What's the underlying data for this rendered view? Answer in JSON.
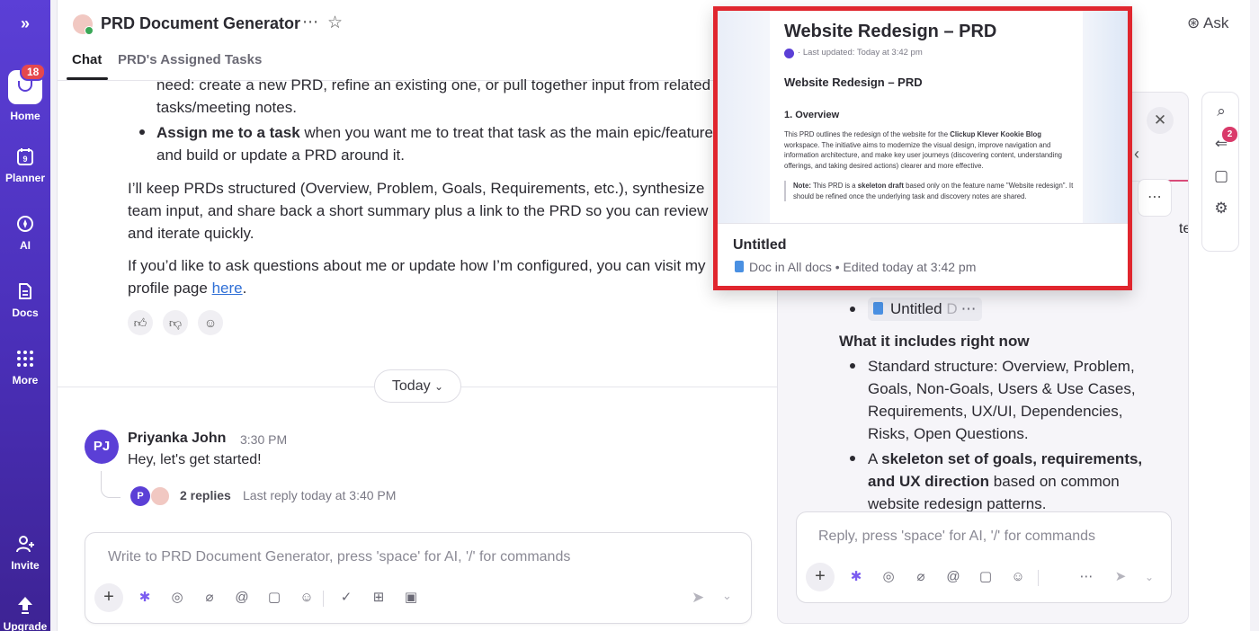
{
  "rail": {
    "home_badge": "18",
    "items": [
      {
        "label": "Home"
      },
      {
        "label": "Planner"
      },
      {
        "label": "AI"
      },
      {
        "label": "Docs"
      },
      {
        "label": "More"
      },
      {
        "label": "Invite"
      },
      {
        "label": "Upgrade"
      }
    ]
  },
  "header": {
    "title": "PRD Document Generator",
    "more_icon": "⋯",
    "tabs": [
      {
        "label": "Chat"
      },
      {
        "label": "PRD's Assigned Tasks"
      }
    ],
    "ask_label": "Ask"
  },
  "chat": {
    "line1": "need: create a new PRD, refine an existing one, or pull together input from related",
    "line2": "tasks/meeting notes.",
    "assign_bold": "Assign me to a task",
    "assign_rest": " when you want me to treat that task as the main epic/feature",
    "assign_line2": "and build or update a PRD around it.",
    "para1_l1": "I’ll keep PRDs structured (Overview, Problem, Goals, Requirements, etc.), synthesize",
    "para1_l2": "team input, and share back a short summary plus a link to the PRD so you can review",
    "para1_l3": "and iterate quickly.",
    "para2_l1": "If you’d like to ask questions about me or update how I’m configured, you can visit my",
    "para2_l2_pre": "profile page ",
    "para2_link": "here",
    "para2_l2_post": ".",
    "today_label": "Today",
    "message": {
      "initials": "PJ",
      "author": "Priyanka John",
      "time": "3:30 PM",
      "text": "Hey, let's get started!",
      "reply_initial": "P",
      "replies": "2 replies",
      "last_reply": "Last reply today at 3:40 PM"
    },
    "composer_placeholder": "Write to PRD Document Generator, press 'space' for AI, '/' for commands"
  },
  "panel": {
    "partial_text": "te",
    "doc_chip_label": "Untitled",
    "doc_chip_faded": "D",
    "includes_heading": "What it includes right now",
    "bullet1_l1": "Standard structure: Overview, Problem,",
    "bullet1_l2": "Goals, Non-Goals, Users & Use Cases,",
    "bullet1_l3": "Requirements, UX/UI, Dependencies,",
    "bullet1_l4": "Risks, Open Questions.",
    "bullet2_pre": "A ",
    "bullet2_bold1": "skeleton set of goals, requirements,",
    "bullet2_bold2": "and UX direction",
    "bullet2_rest": " based on common",
    "bullet2_l3": "website redesign patterns.",
    "composer_placeholder": "Reply, press 'space' for AI, '/' for commands"
  },
  "tools": {
    "badge": "2"
  },
  "popover": {
    "preview_title": "Website Redesign – PRD",
    "preview_meta": "Last updated: Today at 3:42 pm",
    "preview_h2": "Website Redesign – PRD",
    "preview_h3": "1. Overview",
    "body_pre": "This PRD outlines the redesign of the website for the ",
    "body_bold": "Clickup Klever Kookie Blog",
    "body_post": " workspace. The initiative aims to modernize the visual design, improve navigation and information architecture, and make key user journeys (discovering content, understanding offerings, and taking desired actions) clearer and more effective.",
    "note_label": "Note:",
    "note_pre": " This PRD is a ",
    "note_bold": "skeleton draft",
    "note_post": " based only on the feature name \"Website redesign\". It should be refined once the underlying task and discovery notes are shared.",
    "doc_name": "Untitled",
    "doc_info": "Doc in All docs • Edited today at 3:42 pm"
  },
  "colors": {
    "rail_purple": "#5b3fd6",
    "highlight_red": "#e0262e",
    "link_blue": "#2f6fd6",
    "badge_red": "#e5484d"
  }
}
